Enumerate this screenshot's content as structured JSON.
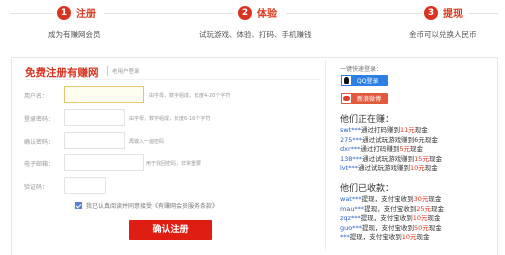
{
  "steps": [
    {
      "num": "1",
      "label": "注册",
      "desc": "成为有赚网会员"
    },
    {
      "num": "2",
      "label": "体验",
      "desc": "试玩游戏、体验、打码、手机赚钱"
    },
    {
      "num": "3",
      "label": "提现",
      "desc": "金币可以兑换人民币"
    }
  ],
  "form": {
    "title": "免费注册有赚网",
    "subtitle": "老用户登录",
    "fields": [
      {
        "label": "用户名：",
        "value": "",
        "hint": "由字母，数字组成，长度4-20个字符"
      },
      {
        "label": "登录密码：",
        "value": "",
        "hint": "由字母，数字组成，长度6-16个字符"
      },
      {
        "label": "确认密码：",
        "value": "",
        "hint": "再输入一遍密码"
      },
      {
        "label": "电子邮箱：",
        "value": "",
        "hint": "用于找回密码，非常重要"
      },
      {
        "label": "验证码：",
        "value": "",
        "hint": ""
      }
    ],
    "agree_text": "我已认真阅读并同意接受《有赚网会员服务条款》",
    "agree_checked": true,
    "submit_label": "确认注册"
  },
  "quick_login": {
    "title": "一键快速登录：",
    "qq_label": "QQ登录",
    "weibo_label": "新浪微博"
  },
  "earning": {
    "title": "他们正在赚：",
    "items": [
      {
        "user": "swt***",
        "text": "通过打码赚到",
        "amount": "11元",
        "suffix": "现金"
      },
      {
        "user": "275***",
        "text": "通过试玩游戏赚到6元",
        "amount": "",
        "suffix": "现金"
      },
      {
        "user": "dxr***",
        "text": "通过打码赚到",
        "amount": "5元",
        "suffix": "现金"
      },
      {
        "user": "138***",
        "text": "通过试玩游戏赚到",
        "amount": "15元",
        "suffix": "现金"
      },
      {
        "user": "lvt***",
        "text": "通过试玩游戏赚到",
        "amount": "10元",
        "suffix": "现金"
      }
    ]
  },
  "withdrawn": {
    "title": "他们已收款：",
    "items": [
      {
        "user": "wat***",
        "text": "提现，支付宝收到",
        "amount": "30元",
        "suffix": "现金"
      },
      {
        "user": "mau***",
        "text": "提现，支付宝收到",
        "amount": "25元",
        "suffix": "现金"
      },
      {
        "user": "zqz***",
        "text": "提现，支付宝收到",
        "amount": "10元",
        "suffix": "现金"
      },
      {
        "user": "guo***",
        "text": "提现，支付宝收到",
        "amount": "50元",
        "suffix": "现金"
      },
      {
        "user": "***",
        "text": "提现，支付宝收到",
        "amount": "10元",
        "suffix": "现金"
      }
    ]
  },
  "colors": {
    "accent": "#d9331f",
    "button": "#e01d13",
    "qq": "#2c7fe3",
    "weibo": "#e25a3d",
    "link": "#2a62c9"
  }
}
